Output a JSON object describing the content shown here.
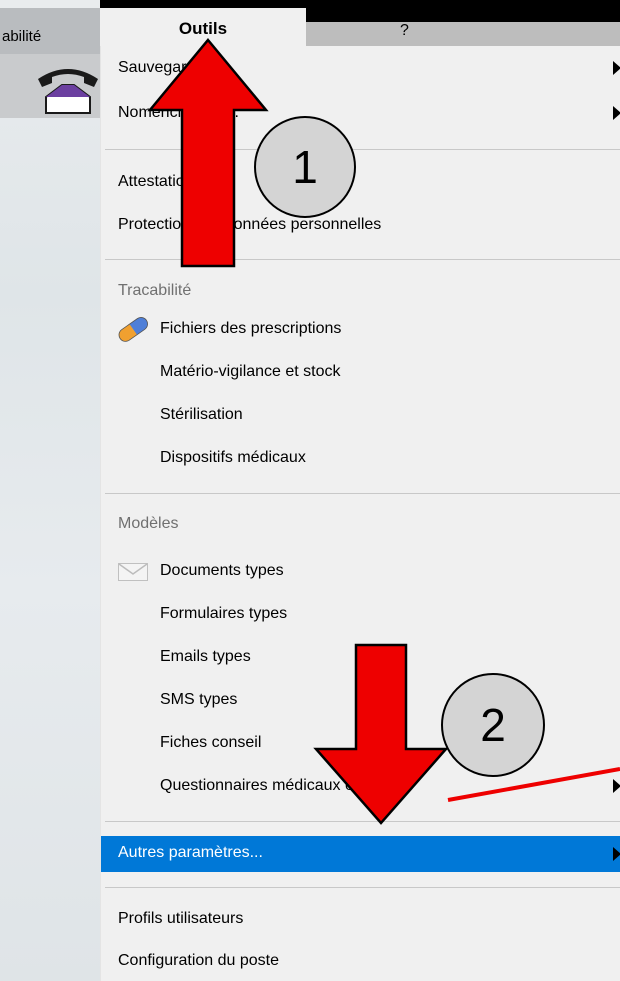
{
  "left_panel": {
    "tab_label": "abilité"
  },
  "tabs": {
    "outils": "Outils",
    "help": "?"
  },
  "menu": {
    "items": [
      {
        "label": "Sauvegarde...",
        "has_submenu": true
      },
      {
        "label": "Nomenclatures...",
        "has_submenu": true
      },
      {
        "label": "Attestation DMP",
        "has_submenu": false
      },
      {
        "label": "Protection des données personnelles",
        "has_submenu": false
      }
    ],
    "tracabilite": {
      "header": "Tracabilité",
      "items": [
        {
          "label": "Fichiers des prescriptions",
          "icon": "pill-icon"
        },
        {
          "label": "Matério-vigilance et stock"
        },
        {
          "label": "Stérilisation"
        },
        {
          "label": "Dispositifs médicaux"
        }
      ]
    },
    "modeles": {
      "header": "Modèles",
      "items": [
        {
          "label": "Documents types",
          "icon": "envelope-icon"
        },
        {
          "label": "Formulaires types"
        },
        {
          "label": "Emails types"
        },
        {
          "label": "SMS types"
        },
        {
          "label": "Fiches conseil"
        },
        {
          "label": "Questionnaires médicaux en ligne",
          "has_submenu": true
        }
      ]
    },
    "autres": {
      "label": "Autres paramètres...",
      "has_submenu": true,
      "highlighted": true
    },
    "bottom_items": [
      {
        "label": "Profils utilisateurs"
      },
      {
        "label": "Configuration du poste"
      }
    ]
  },
  "annotations": {
    "step1": "1",
    "step2": "2",
    "arrow_color": "#ff0000"
  },
  "colors": {
    "highlight": "#0078d7",
    "menu_bg": "#f0f0f0"
  }
}
